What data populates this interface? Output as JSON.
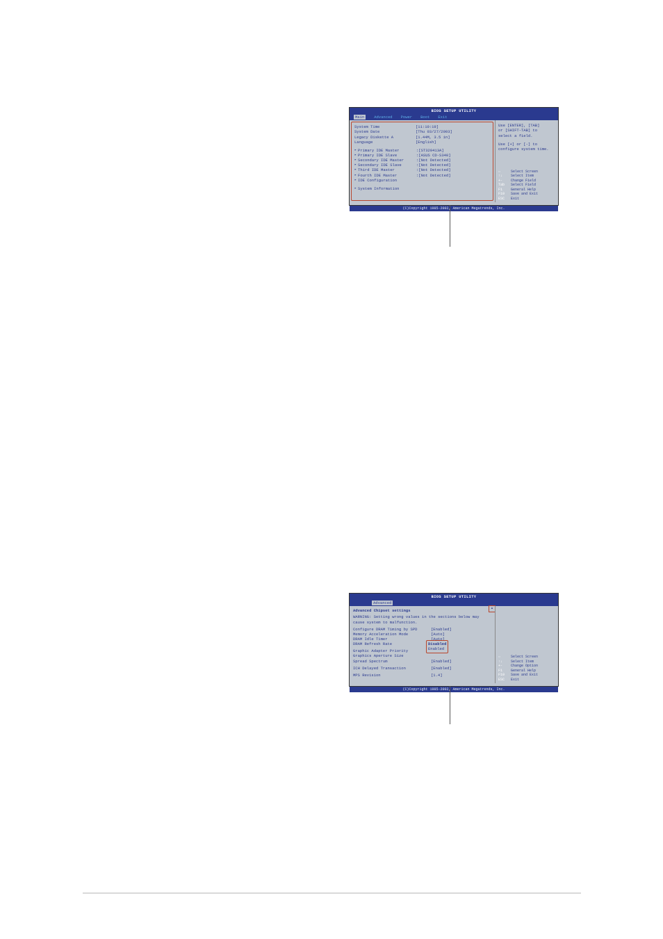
{
  "bios1": {
    "title": "BIOS SETUP UTILITY",
    "menu": {
      "main": "Main",
      "advanced": "Advanced",
      "power": "Power",
      "boot": "Boot",
      "exit": "Exit"
    },
    "rows": [
      {
        "label": "System Time",
        "value": "[11:10:19]"
      },
      {
        "label": "System Date",
        "value": "[Thu 03/27/2003]"
      },
      {
        "label": "Legacy Diskette A",
        "value": "[1.44M, 3.5 in]"
      },
      {
        "label": "Language",
        "value": "[English]"
      }
    ],
    "subrows": [
      {
        "label": "Primary IDE Master",
        "value": ":[ST320413A]"
      },
      {
        "label": "Primary IDE Slave",
        "value": ":[ASUS CD-S340]"
      },
      {
        "label": "Secondary IDE Master",
        "value": ":[Not Detected]"
      },
      {
        "label": "Secondary IDE Slave",
        "value": ":[Not Detected]"
      },
      {
        "label": "Third IDE Master",
        "value": ":[Not Detected]"
      },
      {
        "label": "Fourth IDE Master",
        "value": ":[Not Detected]"
      },
      {
        "label": "IDE Configuration",
        "value": ""
      }
    ],
    "sysinfo": "System Information",
    "help1": "Use [ENTER], [TAB]",
    "help2": "or [SHIFT-TAB] to",
    "help3": "select a field.",
    "help4": "Use [+] or [-] to",
    "help5": "configure system time.",
    "nav": [
      {
        "key": "⇔",
        "desc": "Select Screen"
      },
      {
        "key": "↑↓",
        "desc": "Select Item"
      },
      {
        "key": "+-",
        "desc": "Change Field"
      },
      {
        "key": "Tab",
        "desc": "Select Field"
      },
      {
        "key": "F1",
        "desc": "General Help"
      },
      {
        "key": "F10",
        "desc": "Save and Exit"
      },
      {
        "key": "ESC",
        "desc": "Exit"
      }
    ],
    "footer": "(C)Copyright 1985-2002, American Megatrends, Inc."
  },
  "bios2": {
    "title": "BIOS SETUP UTILITY",
    "menu": {
      "advanced": "Advanced"
    },
    "section": "Advanced Chipset settings",
    "warning": "WARNING: Setting wrong values in the sections below may cause system to malfunction.",
    "rows": [
      {
        "label": "Configure DRAM Timing by SPD",
        "value": "[Enabled]"
      },
      {
        "label": "Memory Acceleration Mode",
        "value": "[Auto]"
      },
      {
        "label": "DRAM Idle Timer",
        "value": "[Auto]"
      },
      {
        "label": "DRAM Refresh Rate",
        "value": ""
      }
    ],
    "options": {
      "opt1": "Disabled",
      "opt2": "Enabled"
    },
    "rows2": [
      {
        "label": "Graphic Adapter Priority",
        "value": ""
      },
      {
        "label": "Graphics Aperture Size",
        "value": ""
      },
      {
        "label": "Spread Spectrum",
        "value": "[Enabled]"
      }
    ],
    "rows3": [
      {
        "label": "ICH Delayed Transaction",
        "value": "[Enabled]"
      }
    ],
    "rows4": [
      {
        "label": "MPS Revision",
        "value": "[1.4]"
      }
    ],
    "nav": [
      {
        "key": "⇔",
        "desc": "Select Screen"
      },
      {
        "key": "↑↓",
        "desc": "Select Item"
      },
      {
        "key": "+-",
        "desc": "Change Option"
      },
      {
        "key": "F1",
        "desc": "General Help"
      },
      {
        "key": "F10",
        "desc": "Save and Exit"
      },
      {
        "key": "ESC",
        "desc": "Exit"
      }
    ],
    "footer": "(C)Copyright 1985-2002, American Megatrends, Inc."
  }
}
